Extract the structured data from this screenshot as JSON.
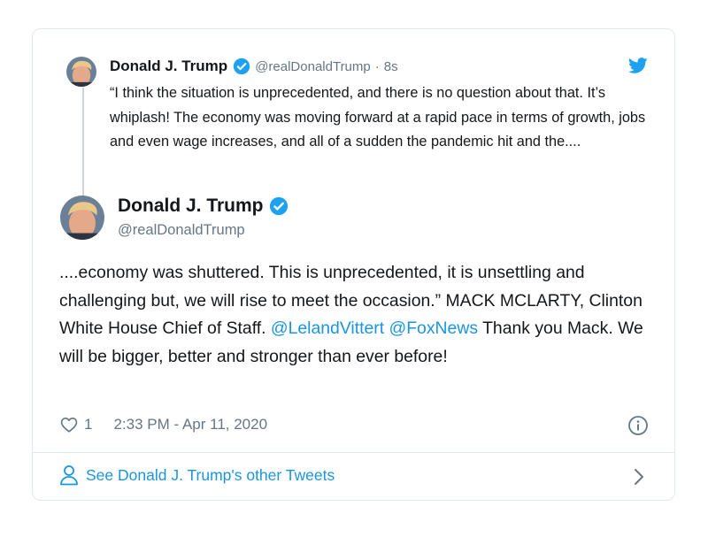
{
  "quoted_tweet": {
    "name": "Donald J. Trump",
    "handle": "@realDonaldTrump",
    "separator": "·",
    "time": "8s",
    "text": "“I think the situation is unprecedented, and there is no question about that. It’s whiplash! The economy was moving forward at a rapid pace in terms of growth, jobs and even wage increases, and all of a sudden the pandemic hit and the...."
  },
  "main_tweet": {
    "name": "Donald J. Trump",
    "handle": "@realDonaldTrump",
    "text_part1": "....economy was shuttered. This is unprecedented, it is unsettling and challenging but, we will rise to meet the occasion.” MACK MCLARTY, Clinton White House Chief of Staff. ",
    "mention1": "@LelandVittert",
    "text_space": " ",
    "mention2": "@FoxNews",
    "text_part2": " Thank you Mack. We will be bigger, better and stronger than ever before!"
  },
  "meta": {
    "like_count": "1",
    "timestamp": "2:33 PM - Apr 11, 2020"
  },
  "footer": {
    "link_label": "See Donald J. Trump's other Tweets"
  },
  "icons": {
    "bird": "twitter-bird-icon",
    "verified": "verified-badge-icon",
    "heart": "heart-icon",
    "info": "info-icon",
    "person": "person-icon",
    "chevron": "chevron-right-icon"
  },
  "colors": {
    "accent": "#1da1f2",
    "link": "#1b95e0",
    "secondary_text": "#657786",
    "border": "#e1e8ed"
  }
}
